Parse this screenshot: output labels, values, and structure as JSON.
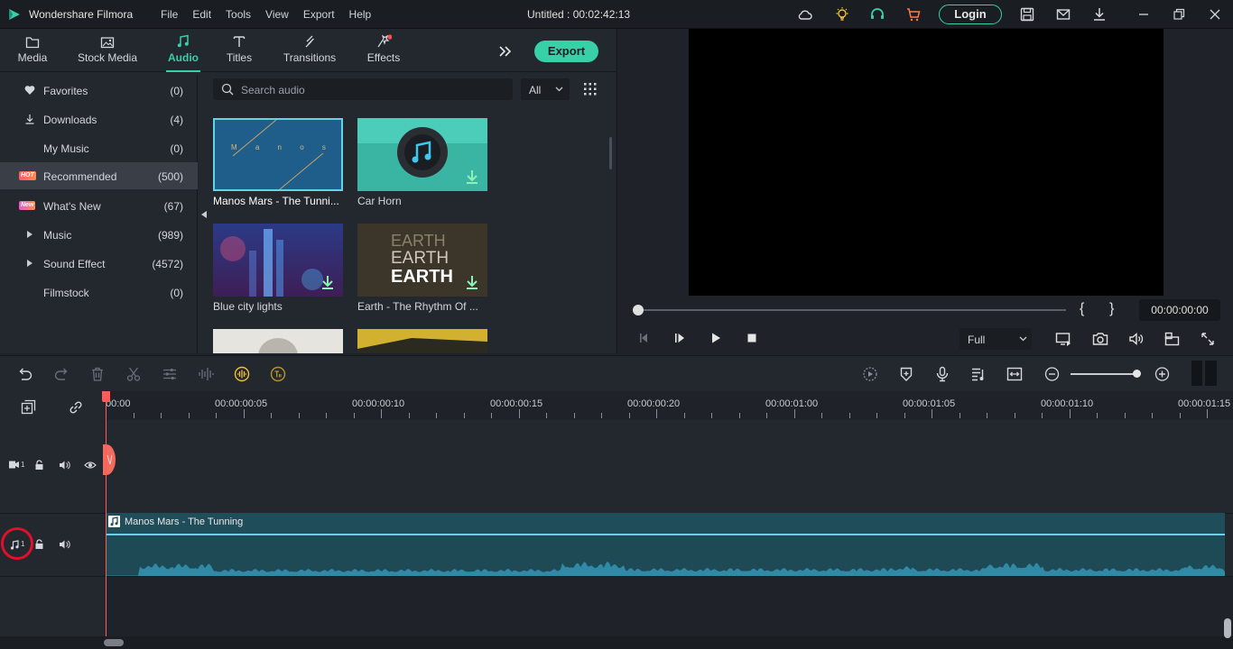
{
  "app": {
    "name": "Wondershare Filmora",
    "menu": [
      "File",
      "Edit",
      "Tools",
      "View",
      "Export",
      "Help"
    ],
    "document_title": "Untitled : 00:02:42:13",
    "login_label": "Login"
  },
  "tabs": [
    {
      "label": "Media",
      "icon": "folder-icon"
    },
    {
      "label": "Stock Media",
      "icon": "stock-media-icon"
    },
    {
      "label": "Audio",
      "icon": "music-note-icon",
      "active": true
    },
    {
      "label": "Titles",
      "icon": "text-t-icon"
    },
    {
      "label": "Transitions",
      "icon": "transitions-icon"
    },
    {
      "label": "Effects",
      "icon": "effects-icon"
    }
  ],
  "export_label": "Export",
  "sidebar": {
    "items": [
      {
        "label": "Favorites",
        "count": "(0)",
        "icon": "heart-icon"
      },
      {
        "label": "Downloads",
        "count": "(4)",
        "icon": "download-icon"
      },
      {
        "label": "My Music",
        "count": "(0)"
      },
      {
        "label": "Recommended",
        "count": "(500)",
        "badge": "HOT"
      },
      {
        "label": "What's New",
        "count": "(67)",
        "badge": "New"
      },
      {
        "label": "Music",
        "count": "(989)"
      },
      {
        "label": "Sound Effect",
        "count": "(4572)"
      },
      {
        "label": "Filmstock",
        "count": "(0)"
      }
    ]
  },
  "search": {
    "placeholder": "Search audio"
  },
  "filter": {
    "value": "All"
  },
  "library": [
    {
      "caption": "Manos Mars - The Tunni...",
      "thumb_text": "M a n o s   M a r s"
    },
    {
      "caption": "Car Horn"
    },
    {
      "caption": "Blue city lights"
    },
    {
      "caption": "Earth - The Rhythm Of ...",
      "thumb_text": [
        "EARTH",
        "EARTH",
        "EARTH"
      ]
    }
  ],
  "preview": {
    "timecode": "00:00:00:00",
    "quality": "Full",
    "brace_open": "{",
    "brace_close": "}"
  },
  "timeline": {
    "ruler_labels": [
      "00:00",
      "00:00:00:05",
      "00:00:00:10",
      "00:00:00:15",
      "00:00:00:20",
      "00:00:01:00",
      "00:00:01:05",
      "00:00:01:10",
      "00:00:01:15"
    ],
    "video_track_label": "1",
    "audio_track_label": "1",
    "audio_clip_title": "Manos Mars - The Tunning"
  },
  "colors": {
    "accent": "#37d0a7",
    "clip": "#1e4a55",
    "wave": "#2f8aa6",
    "playhead": "#ff5b5b"
  }
}
